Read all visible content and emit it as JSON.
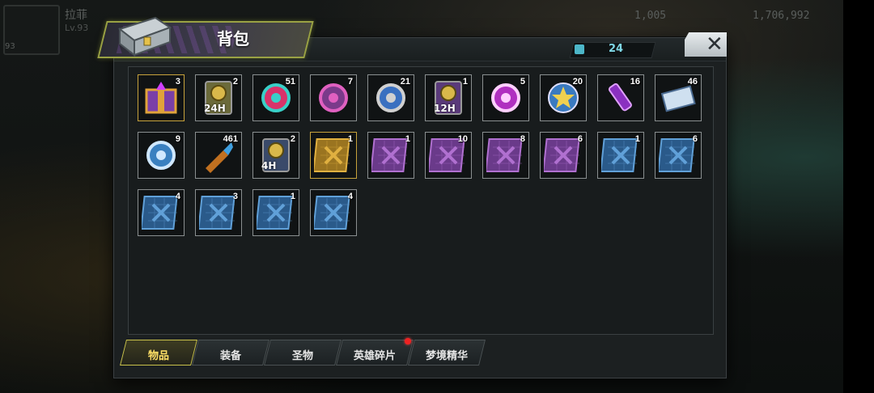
{
  "hud": {
    "player_name": "拉菲",
    "level": "Lv.93",
    "avatar_level": "93",
    "currency_1": "1,005",
    "currency_2": "1,706,992"
  },
  "dialog": {
    "title": "背包",
    "capacity": "24",
    "close_label": "✕"
  },
  "items": [
    {
      "name": "lucky-box",
      "count": "3",
      "frame": "#c7a23c",
      "icon": "box-icon",
      "colors": [
        "#7a3fa8",
        "#e0a33a"
      ]
    },
    {
      "name": "coin-card-24h",
      "count": "2",
      "frame": "#8a8f90",
      "icon": "coin-card-icon",
      "label": "24H",
      "colors": [
        "#6b6a3a",
        "#d9b84a"
      ]
    },
    {
      "name": "energy-candy",
      "count": "51",
      "frame": "#8a8f90",
      "icon": "candy-icon",
      "colors": [
        "#d8336a",
        "#39d0c8"
      ]
    },
    {
      "name": "film-reel",
      "count": "7",
      "frame": "#8a8f90",
      "icon": "film-reel-icon",
      "colors": [
        "#7a3a8a",
        "#e060c0"
      ]
    },
    {
      "name": "spring-gadget",
      "count": "21",
      "frame": "#8a8f90",
      "icon": "gadget-icon",
      "colors": [
        "#3a70c0",
        "#d0d0d0"
      ]
    },
    {
      "name": "coin-card-12h",
      "count": "1",
      "frame": "#8a8f90",
      "icon": "coin-card-icon",
      "label": "12H",
      "colors": [
        "#5a3a7a",
        "#d9b84a"
      ]
    },
    {
      "name": "purple-candy",
      "count": "5",
      "frame": "#8a8f90",
      "icon": "candy-icon",
      "colors": [
        "#b030c0",
        "#ffd0ff"
      ]
    },
    {
      "name": "star-badge",
      "count": "20",
      "frame": "#8a8f90",
      "icon": "star-badge-icon",
      "colors": [
        "#3a7ac0",
        "#f0d050"
      ]
    },
    {
      "name": "syringe",
      "count": "16",
      "frame": "#8a8f90",
      "icon": "syringe-icon",
      "colors": [
        "#8a30c0",
        "#e0a0ff"
      ]
    },
    {
      "name": "cinema-ticket",
      "count": "46",
      "frame": "#8a8f90",
      "icon": "ticket-icon",
      "colors": [
        "#4a6a90",
        "#cfe0f0"
      ]
    },
    {
      "name": "blue-token",
      "count": "9",
      "frame": "#8a8f90",
      "icon": "token-icon",
      "colors": [
        "#3a80c0",
        "#d0e8ff"
      ]
    },
    {
      "name": "bullet",
      "count": "461",
      "frame": "#8a8f90",
      "icon": "bullet-icon",
      "colors": [
        "#c07020",
        "#40a0e0"
      ]
    },
    {
      "name": "coin-card-4h",
      "count": "2",
      "frame": "#8a8f90",
      "icon": "coin-card-icon",
      "label": "4H",
      "colors": [
        "#3a4a6a",
        "#d9b84a"
      ]
    },
    {
      "name": "gold-weapon-blueprint",
      "count": "1",
      "frame": "#c7a23c",
      "icon": "crossed-guns-icon",
      "colors": [
        "#9a7420",
        "#e0b040"
      ]
    },
    {
      "name": "purple-weapon-blueprint",
      "count": "1",
      "frame": "#8a8f90",
      "icon": "crossed-guns-icon",
      "colors": [
        "#6a3a8a",
        "#b070d0"
      ]
    },
    {
      "name": "purple-shirt-blueprint",
      "count": "10",
      "frame": "#8a8f90",
      "icon": "shirt-icon",
      "colors": [
        "#6a3a8a",
        "#b070d0"
      ]
    },
    {
      "name": "purple-boots-blueprint",
      "count": "8",
      "frame": "#8a8f90",
      "icon": "boots-icon",
      "colors": [
        "#6a3a8a",
        "#b070d0"
      ]
    },
    {
      "name": "purple-hat-blueprint",
      "count": "6",
      "frame": "#8a8f90",
      "icon": "hat-icon",
      "colors": [
        "#6a3a8a",
        "#b070d0"
      ]
    },
    {
      "name": "blue-shirt-blueprint",
      "count": "1",
      "frame": "#8a8f90",
      "icon": "shirt-icon",
      "colors": [
        "#2a5a8a",
        "#60a0d8"
      ]
    },
    {
      "name": "blue-weapon-blueprint",
      "count": "6",
      "frame": "#8a8f90",
      "icon": "crossed-guns-icon",
      "colors": [
        "#2a5a8a",
        "#60a0d8"
      ]
    },
    {
      "name": "blue-boots-blueprint",
      "count": "4",
      "frame": "#8a8f90",
      "icon": "boots-icon",
      "colors": [
        "#2a5a8a",
        "#60a0d8"
      ]
    },
    {
      "name": "blue-guns-blueprint",
      "count": "3",
      "frame": "#8a8f90",
      "icon": "crossed-guns-icon",
      "colors": [
        "#2a5a8a",
        "#60a0d8"
      ]
    },
    {
      "name": "blue-pistol-blueprint",
      "count": "1",
      "frame": "#8a8f90",
      "icon": "pistol-icon",
      "colors": [
        "#2a5a8a",
        "#60a0d8"
      ]
    },
    {
      "name": "blue-hat-blueprint",
      "count": "4",
      "frame": "#8a8f90",
      "icon": "hat-icon",
      "colors": [
        "#2a5a8a",
        "#60a0d8"
      ]
    }
  ],
  "tabs": [
    {
      "label": "物品",
      "active": true
    },
    {
      "label": "装备",
      "active": false
    },
    {
      "label": "圣物",
      "active": false
    },
    {
      "label": "英雄碎片",
      "active": false,
      "badge": true
    },
    {
      "label": "梦境精华",
      "active": false
    }
  ]
}
